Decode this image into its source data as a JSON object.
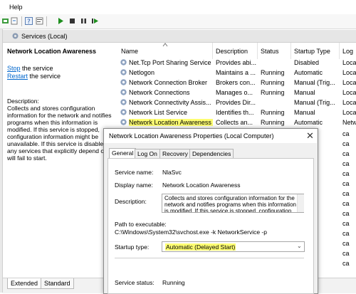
{
  "menubar": {
    "help": "Help"
  },
  "services_header": {
    "title": "Services (Local)"
  },
  "description_pane": {
    "service_name": "Network Location Awareness",
    "stop_link": "Stop",
    "stop_suffix": " the service",
    "restart_link": "Restart",
    "restart_suffix": " the service",
    "description_label": "Description:",
    "description_text": "Collects and stores configuration information for the network and notifies programs when this information is modified. If this service is stopped, configuration information might be unavailable. If this service is disabled, any services that explicitly depend on it will fail to start."
  },
  "columns": [
    "Name",
    "Description",
    "Status",
    "Startup Type",
    "Log"
  ],
  "rows": [
    {
      "name": "Net.Tcp Port Sharing Service",
      "description": "Provides abi...",
      "status": "",
      "startup": "Disabled",
      "log": "Loca"
    },
    {
      "name": "Netlogon",
      "description": "Maintains a ...",
      "status": "Running",
      "startup": "Automatic",
      "log": "Loca"
    },
    {
      "name": "Network Connection Broker",
      "description": "Brokers con...",
      "status": "Running",
      "startup": "Manual (Trig...",
      "log": "Loca"
    },
    {
      "name": "Network Connections",
      "description": "Manages o...",
      "status": "Running",
      "startup": "Manual",
      "log": "Loca"
    },
    {
      "name": "Network Connectivity Assis...",
      "description": "Provides Dir...",
      "status": "",
      "startup": "Manual (Trig...",
      "log": "Loca"
    },
    {
      "name": "Network List Service",
      "description": "Identifies th...",
      "status": "Running",
      "startup": "Manual",
      "log": "Loca"
    },
    {
      "name": "Network Location Awareness",
      "description": "Collects an...",
      "status": "Running",
      "startup": "Automatic",
      "log": "Netw"
    }
  ],
  "log_column_rest": [
    "ca",
    "ca",
    "ca",
    "ca",
    "ca",
    "ca",
    "ca",
    "ca",
    "ca",
    "ca",
    "ca",
    "ca",
    "ca",
    "ca"
  ],
  "bottom_tabs": [
    "Extended",
    "Standard"
  ],
  "dialog": {
    "title": "Network Location Awareness Properties (Local Computer)",
    "close": "✕",
    "tabs": [
      "General",
      "Log On",
      "Recovery",
      "Dependencies"
    ],
    "service_name_label": "Service name:",
    "service_name_value": "NlaSvc",
    "display_name_label": "Display name:",
    "display_name_value": "Network Location Awareness",
    "description_label": "Description:",
    "description_value": "Collects and stores configuration information for the network and notifies programs when this information is modified. If this service is stopped, configuration",
    "path_label": "Path to executable:",
    "path_value": "C:\\Windows\\System32\\svchost.exe -k NetworkService -p",
    "startup_label": "Startup type:",
    "startup_value": "Automatic (Delayed Start)",
    "status_label": "Service status:",
    "status_value": "Running"
  },
  "colors": {
    "highlight": "#fdfd72",
    "link": "#0066cc",
    "selection": "#cce8ff"
  },
  "icons": [
    "back-icon",
    "forward-icon",
    "help-icon",
    "play-icon",
    "stop-icon",
    "pause-icon",
    "restart-icon",
    "gear-icon",
    "close-icon",
    "chevron-down-icon",
    "sort-arrow-icon"
  ]
}
